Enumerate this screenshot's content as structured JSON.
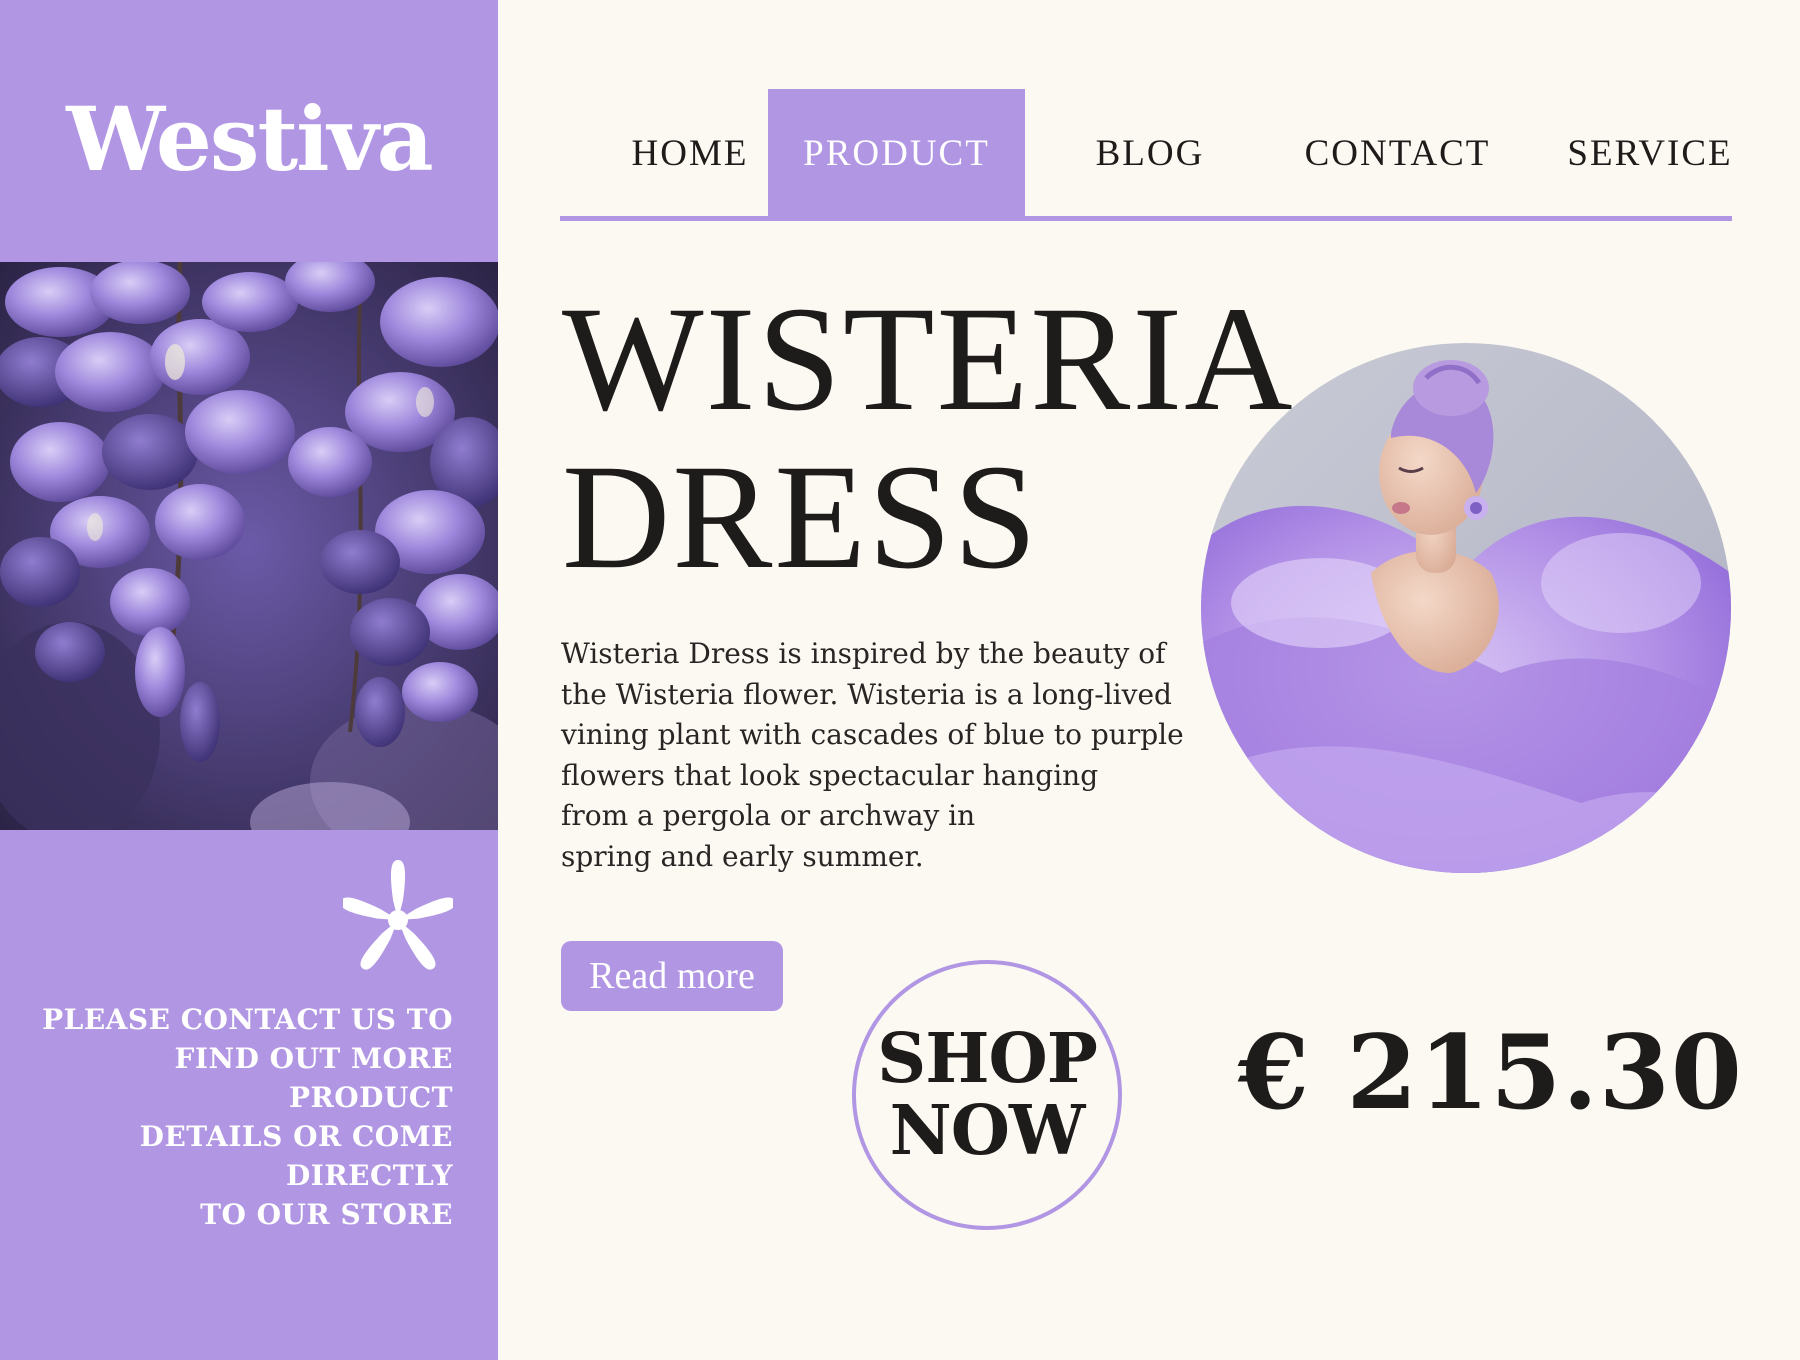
{
  "brand": {
    "name": "Westiva"
  },
  "nav": {
    "items": [
      {
        "label": "HOME",
        "active": false
      },
      {
        "label": "PRODUCT",
        "active": true
      },
      {
        "label": "BLOG",
        "active": false
      },
      {
        "label": "CONTACT",
        "active": false
      },
      {
        "label": "SERVICE",
        "active": false
      }
    ]
  },
  "hero": {
    "title_lines": [
      "WISTERIA",
      "DRESS"
    ],
    "description_lines": [
      "Wisteria Dress is inspired by the beauty of",
      "the Wisteria flower. Wisteria is a long-lived",
      "vining plant with cascades of blue to purple",
      "flowers that look spectacular hanging",
      "from a pergola or archway in",
      "spring and early summer."
    ],
    "read_more_label": "Read more",
    "shop_now_lines": [
      "SHOP",
      "NOW"
    ],
    "price": "€ 215.30"
  },
  "sidebar": {
    "contact_lines": [
      "PLEASE CONTACT US TO",
      "FIND OUT MORE PRODUCT",
      "DETAILS OR COME DIRECTLY",
      "TO OUR STORE"
    ]
  },
  "icons": {
    "decoration": "asterisk-icon"
  },
  "colors": {
    "accent": "#b196e4",
    "background": "#fcf9f2",
    "text": "#1e1b1b"
  }
}
